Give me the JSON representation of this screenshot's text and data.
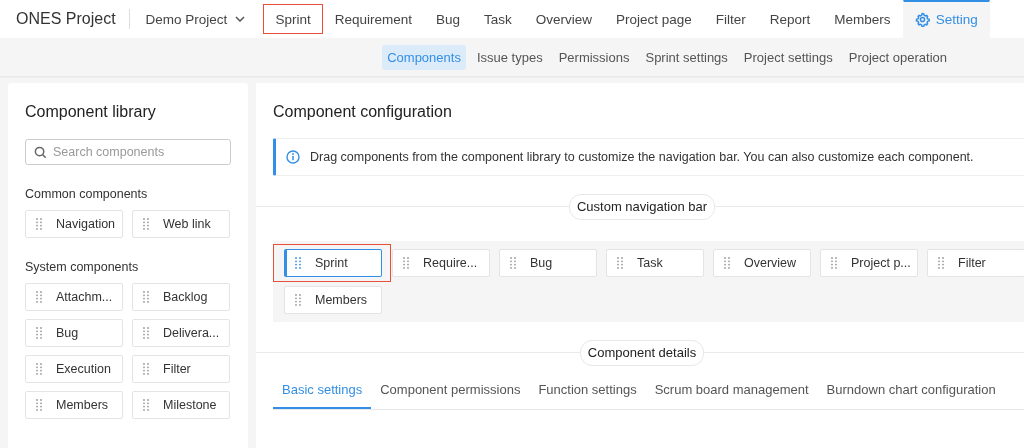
{
  "header": {
    "brand": "ONES Project",
    "project": "Demo Project",
    "nav": [
      {
        "label": "Sprint",
        "selected": false,
        "highlighted": true
      },
      {
        "label": "Requirement",
        "selected": false,
        "highlighted": false
      },
      {
        "label": "Bug",
        "selected": false,
        "highlighted": false
      },
      {
        "label": "Task",
        "selected": false,
        "highlighted": false
      },
      {
        "label": "Overview",
        "selected": false,
        "highlighted": false
      },
      {
        "label": "Project page",
        "selected": false,
        "highlighted": false
      },
      {
        "label": "Filter",
        "selected": false,
        "highlighted": false
      },
      {
        "label": "Report",
        "selected": false,
        "highlighted": false
      },
      {
        "label": "Members",
        "selected": false,
        "highlighted": false
      },
      {
        "label": "Setting",
        "selected": true,
        "highlighted": false
      }
    ]
  },
  "subnav": [
    {
      "label": "Components",
      "selected": true
    },
    {
      "label": "Issue types",
      "selected": false
    },
    {
      "label": "Permissions",
      "selected": false
    },
    {
      "label": "Sprint settings",
      "selected": false
    },
    {
      "label": "Project settings",
      "selected": false
    },
    {
      "label": "Project operation",
      "selected": false
    }
  ],
  "library": {
    "title": "Component library",
    "search": {
      "placeholder": "Search components"
    },
    "groups": [
      {
        "title": "Common components",
        "items": [
          "Navigation",
          "Web link"
        ]
      },
      {
        "title": "System components",
        "items": [
          "Attachm...",
          "Backlog",
          "Bug",
          "Delivera...",
          "Execution",
          "Filter",
          "Members",
          "Milestone"
        ]
      }
    ]
  },
  "config": {
    "title": "Component configuration",
    "info": "Drag components from the component library to customize the navigation bar. You can also customize each component.",
    "nav_section": "Custom navigation bar",
    "nav_items": [
      {
        "label": "Sprint",
        "selected": true,
        "highlighted": true
      },
      {
        "label": "Require...",
        "selected": false,
        "highlighted": false
      },
      {
        "label": "Bug",
        "selected": false,
        "highlighted": false
      },
      {
        "label": "Task",
        "selected": false,
        "highlighted": false
      },
      {
        "label": "Overview",
        "selected": false,
        "highlighted": false
      },
      {
        "label": "Project p...",
        "selected": false,
        "highlighted": false
      },
      {
        "label": "Filter",
        "selected": false,
        "highlighted": false
      },
      {
        "label": "Members",
        "selected": false,
        "highlighted": false
      }
    ],
    "details_section": "Component details",
    "tabs": [
      {
        "label": "Basic settings",
        "selected": true
      },
      {
        "label": "Component permissions",
        "selected": false
      },
      {
        "label": "Function settings",
        "selected": false
      },
      {
        "label": "Scrum board management",
        "selected": false
      },
      {
        "label": "Burndown chart configuration",
        "selected": false
      }
    ]
  }
}
